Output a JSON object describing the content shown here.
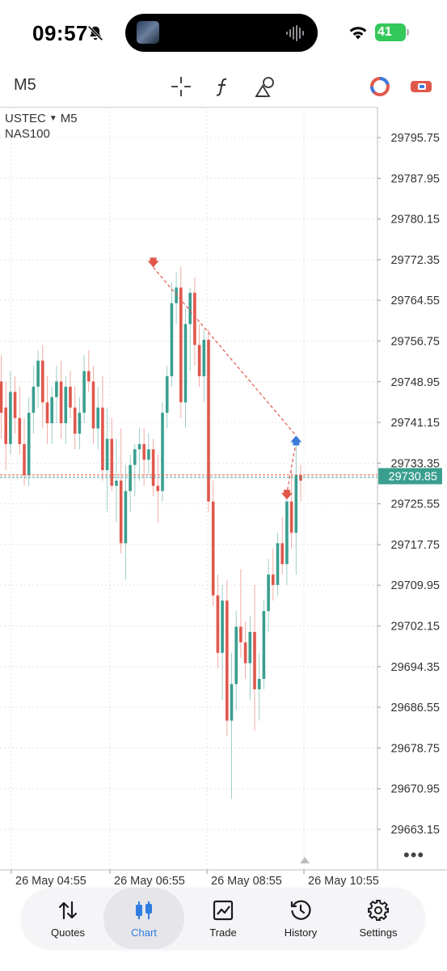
{
  "status_bar": {
    "time": "09:57",
    "battery": "41",
    "icons": [
      "bell-slash-icon",
      "wifi-icon",
      "battery-icon"
    ]
  },
  "toolbar": {
    "timeframe": "M5",
    "icons": [
      "crosshair-icon",
      "indicators-icon",
      "objects-icon",
      "one-click-trading-icon",
      "account-switch-icon"
    ]
  },
  "chart": {
    "symbol": "USTEC",
    "timeframe": "M5",
    "description": "NAS100",
    "current_price": "29730.85",
    "colors": {
      "bull": "#3a9e8f",
      "bear": "#e0584c",
      "price_tag": "#3a9e8f",
      "arrow_up": "#3b7bdc",
      "arrow_down": "#e0584c"
    }
  },
  "chart_data": {
    "type": "candlestick",
    "price_axis_ticks": [
      "29795.75",
      "29787.95",
      "29780.15",
      "29772.35",
      "29764.55",
      "29756.75",
      "29748.95",
      "29741.15",
      "29733.35",
      "29725.55",
      "29717.75",
      "29709.95",
      "29702.15",
      "29694.35",
      "29686.55",
      "29678.75",
      "29670.95",
      "29663.15"
    ],
    "time_axis_ticks": [
      "26 May 04:55",
      "26 May 06:55",
      "26 May 08:55",
      "26 May 10:55"
    ],
    "ylim": [
      29659.0,
      29801.0
    ],
    "current_price": 29730.85,
    "candles": [
      [
        29749,
        29754,
        29738,
        29743
      ],
      [
        29744,
        29749,
        29732,
        29737
      ],
      [
        29737,
        29751,
        29735,
        29747
      ],
      [
        29747,
        29750,
        29739,
        29742
      ],
      [
        29742,
        29748,
        29735,
        29737
      ],
      [
        29737,
        29742,
        29729,
        29731
      ],
      [
        29731,
        29746,
        29729,
        29743
      ],
      [
        29743,
        29752,
        29739,
        29748
      ],
      [
        29748,
        29755,
        29744,
        29753
      ],
      [
        29753,
        29756,
        29740,
        29745
      ],
      [
        29745,
        29750,
        29737,
        29741
      ],
      [
        29741,
        29748,
        29737,
        29746
      ],
      [
        29746,
        29752,
        29741,
        29749
      ],
      [
        29749,
        29753,
        29738,
        29741
      ],
      [
        29741,
        29750,
        29737,
        29748
      ],
      [
        29748,
        29751,
        29742,
        29744
      ],
      [
        29744,
        29748,
        29736,
        29739
      ],
      [
        29739,
        29746,
        29736,
        29743
      ],
      [
        29743,
        29754,
        29741,
        29751
      ],
      [
        29751,
        29755,
        29747,
        29749
      ],
      [
        29749,
        29752,
        29737,
        29740
      ],
      [
        29740,
        29748,
        29736,
        29744
      ],
      [
        29744,
        29750,
        29730,
        29732
      ],
      [
        29732,
        29744,
        29724,
        29738
      ],
      [
        29738,
        29742,
        29728,
        29729
      ],
      [
        29729,
        29738,
        29722,
        29730
      ],
      [
        29730,
        29740,
        29716,
        29718
      ],
      [
        29718,
        29733,
        29711,
        29728
      ],
      [
        29728,
        29735,
        29724,
        29733
      ],
      [
        29733,
        29737,
        29727,
        29736
      ],
      [
        29736,
        29740,
        29730,
        29737
      ],
      [
        29737,
        29740,
        29729,
        29734
      ],
      [
        29734,
        29739,
        29731,
        29736
      ],
      [
        29736,
        29738,
        29727,
        29729
      ],
      [
        29729,
        29735,
        29722,
        29728
      ],
      [
        29728,
        29745,
        29726,
        29743
      ],
      [
        29743,
        29752,
        29740,
        29750
      ],
      [
        29750,
        29768,
        29748,
        29764
      ],
      [
        29764,
        29770,
        29760,
        29767
      ],
      [
        29767,
        29771,
        29742,
        29745
      ],
      [
        29745,
        29763,
        29740,
        29760
      ],
      [
        29760,
        29767,
        29751,
        29766
      ],
      [
        29766,
        29769,
        29752,
        29756
      ],
      [
        29756,
        29760,
        29748,
        29750
      ],
      [
        29750,
        29759,
        29745,
        29757
      ],
      [
        29757,
        29759,
        29724,
        29726
      ],
      [
        29726,
        29730,
        29706,
        29708
      ],
      [
        29708,
        29712,
        29694,
        29697
      ],
      [
        29697,
        29710,
        29688,
        29707
      ],
      [
        29707,
        29711,
        29681,
        29684
      ],
      [
        29684,
        29697,
        29669,
        29691
      ],
      [
        29691,
        29705,
        29686,
        29702
      ],
      [
        29702,
        29713,
        29696,
        29699
      ],
      [
        29699,
        29703,
        29692,
        29695
      ],
      [
        29695,
        29704,
        29688,
        29701
      ],
      [
        29701,
        29710,
        29682,
        29690
      ],
      [
        29690,
        29697,
        29684,
        29692
      ],
      [
        29692,
        29707,
        29690,
        29705
      ],
      [
        29705,
        29715,
        29701,
        29712
      ],
      [
        29712,
        29717,
        29707,
        29710
      ],
      [
        29710,
        29720,
        29708,
        29718
      ],
      [
        29718,
        29723,
        29712,
        29714
      ],
      [
        29714,
        29728,
        29710,
        29726
      ],
      [
        29726,
        29732,
        29717,
        29720
      ],
      [
        29720,
        29737,
        29712,
        29731
      ],
      [
        29731,
        29733,
        29726,
        29730
      ]
    ],
    "signals": [
      {
        "direction": "sell",
        "price": 29771.5
      },
      {
        "direction": "buy",
        "price": 29738.0
      },
      {
        "direction": "sell",
        "price": 29727.0
      }
    ]
  },
  "nav": {
    "items": [
      {
        "label": "Quotes",
        "icon": "quotes-arrows-icon"
      },
      {
        "label": "Chart",
        "icon": "candlestick-icon"
      },
      {
        "label": "Trade",
        "icon": "trade-chart-icon"
      },
      {
        "label": "History",
        "icon": "history-clock-icon"
      },
      {
        "label": "Settings",
        "icon": "gear-icon"
      }
    ],
    "active": "Chart"
  }
}
